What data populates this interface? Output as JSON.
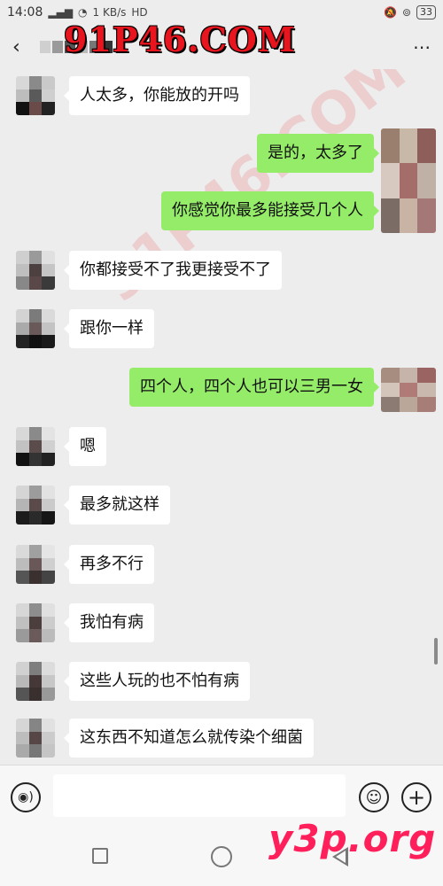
{
  "status_bar": {
    "time": "14:08",
    "network_speed": "1 KB/s",
    "hd_label": "HD",
    "battery": "33"
  },
  "header": {
    "back_icon": "back-arrow-icon",
    "more_icon": "more-icon"
  },
  "watermarks": {
    "top": "91P46.COM",
    "diagonal": "91P46.COM",
    "bottom": "y3p.org"
  },
  "messages": [
    {
      "side": "left",
      "text": "人太多，你能放的开吗"
    },
    {
      "side": "right",
      "text": "是的，太多了"
    },
    {
      "side": "right",
      "text": "你感觉你最多能接受几个人"
    },
    {
      "side": "left",
      "text": "你都接受不了我更接受不了"
    },
    {
      "side": "left",
      "text": "跟你一样"
    },
    {
      "side": "right",
      "text": "四个人，四个人也可以三男一女"
    },
    {
      "side": "left",
      "text": "嗯"
    },
    {
      "side": "left",
      "text": "最多就这样"
    },
    {
      "side": "left",
      "text": "再多不行"
    },
    {
      "side": "left",
      "text": "我怕有病"
    },
    {
      "side": "left",
      "text": "这些人玩的也不怕有病"
    },
    {
      "side": "left",
      "text": "这东西不知道怎么就传染个细菌"
    }
  ],
  "input_bar": {
    "voice_icon": "voice-icon",
    "input_value": "",
    "emoji_icon": "emoji-icon",
    "plus_icon": "plus-icon"
  },
  "colors": {
    "sent_bubble": "#95ec69",
    "received_bubble": "#ffffff",
    "background": "#ededed"
  }
}
